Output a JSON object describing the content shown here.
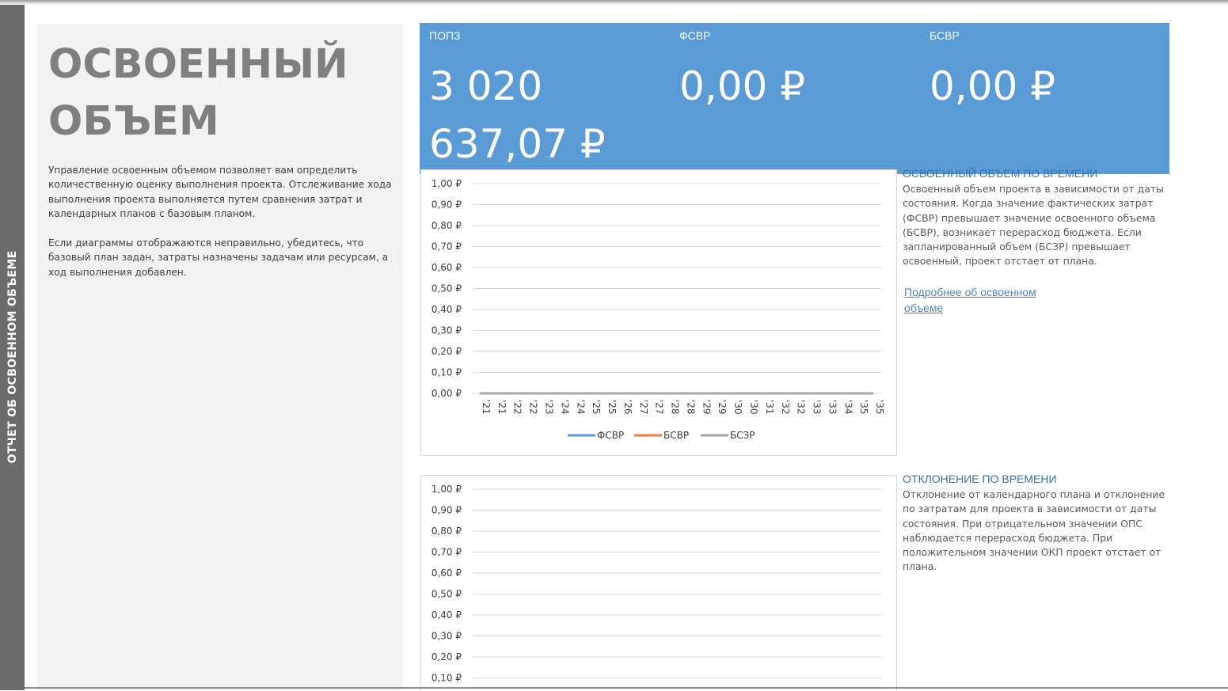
{
  "side_tab": {
    "label": "ОТЧЕТ ОБ ОСВОЕННОМ ОБЪЕМЕ"
  },
  "intro": {
    "title_line1": "ОСВОЕННЫЙ",
    "title_line2": "ОБЪЕМ",
    "paragraph1": "Управление освоенным объемом позволяет вам определить количественную оценку выполнения проекта. Отслеживание хода выполнения проекта выполняется путем сравнения затрат и календарных планов с базовым планом.",
    "paragraph2": "Если диаграммы отображаются неправильно, убедитесь, что базовый план задан, затраты назначены задачам или ресурсам, а ход выполнения добавлен."
  },
  "kpis": [
    {
      "label": "ПОПЗ",
      "value": "3 020 637,07 ₽"
    },
    {
      "label": "ФСВР",
      "value": "0,00 ₽"
    },
    {
      "label": "БСВР",
      "value": "0,00 ₽"
    }
  ],
  "section1": {
    "heading": "ОСВОЕННЫЙ ОБЪЕМ ПО ВРЕМЕНИ",
    "text": "Освоенный объем проекта в зависимости от даты состояния. Когда значение фактических затрат (ФСВР) превышает значение освоенного объема (БСВР), возникает перерасход бюджета. Если запланированный объем (БСЗР) превышает освоенный, проект отстает от плана.",
    "link": "Подробнее об освоенном объеме"
  },
  "section2": {
    "heading": "ОТКЛОНЕНИЕ ПО ВРЕМЕНИ",
    "text": "Отклонение от календарного плана и отклонение по затратам для проекта в зависимости от даты состояния. При отрицательном значении ОПС наблюдается перерасход бюджета. При положительном значении ОКП проект отстает от плана."
  },
  "colors": {
    "accent": "#5b9bd5",
    "series_fsvr": "#5b9bd5",
    "series_bsvr": "#ed7d31",
    "series_bszr": "#a5a5a5"
  },
  "chart_data": [
    {
      "type": "line",
      "title": "",
      "ylim": [
        0,
        1
      ],
      "y_ticks": [
        "0,00 ₽",
        "0,10 ₽",
        "0,20 ₽",
        "0,30 ₽",
        "0,40 ₽",
        "0,50 ₽",
        "0,60 ₽",
        "0,70 ₽",
        "0,80 ₽",
        "0,90 ₽",
        "1,00 ₽"
      ],
      "categories": [
        "'21",
        "'21",
        "'22",
        "'22",
        "'23",
        "'24",
        "'24",
        "'25",
        "'25",
        "'26",
        "'27",
        "'27",
        "'28",
        "'28",
        "'29",
        "'29",
        "'30",
        "'30",
        "'31",
        "'32",
        "'32",
        "'33",
        "'33",
        "'34",
        "'35",
        "'35"
      ],
      "series": [
        {
          "name": "ФСВР",
          "values": [
            0,
            0,
            0,
            0,
            0,
            0,
            0,
            0,
            0,
            0,
            0,
            0,
            0,
            0,
            0,
            0,
            0,
            0,
            0,
            0,
            0,
            0,
            0,
            0,
            0,
            0
          ]
        },
        {
          "name": "БСВР",
          "values": [
            0,
            0,
            0,
            0,
            0,
            0,
            0,
            0,
            0,
            0,
            0,
            0,
            0,
            0,
            0,
            0,
            0,
            0,
            0,
            0,
            0,
            0,
            0,
            0,
            0,
            0
          ]
        },
        {
          "name": "БСЗР",
          "values": [
            0,
            0,
            0,
            0,
            0,
            0,
            0,
            0,
            0,
            0,
            0,
            0,
            0,
            0,
            0,
            0,
            0,
            0,
            0,
            0,
            0,
            0,
            0,
            0,
            0,
            0
          ]
        }
      ],
      "legend": "bottom",
      "grid": true
    },
    {
      "type": "line",
      "title": "",
      "ylim": [
        0,
        1
      ],
      "y_ticks": [
        "0,10 ₽",
        "0,20 ₽",
        "0,30 ₽",
        "0,40 ₽",
        "0,50 ₽",
        "0,60 ₽",
        "0,70 ₽",
        "0,80 ₽",
        "0,90 ₽",
        "1,00 ₽"
      ],
      "grid": true
    }
  ]
}
